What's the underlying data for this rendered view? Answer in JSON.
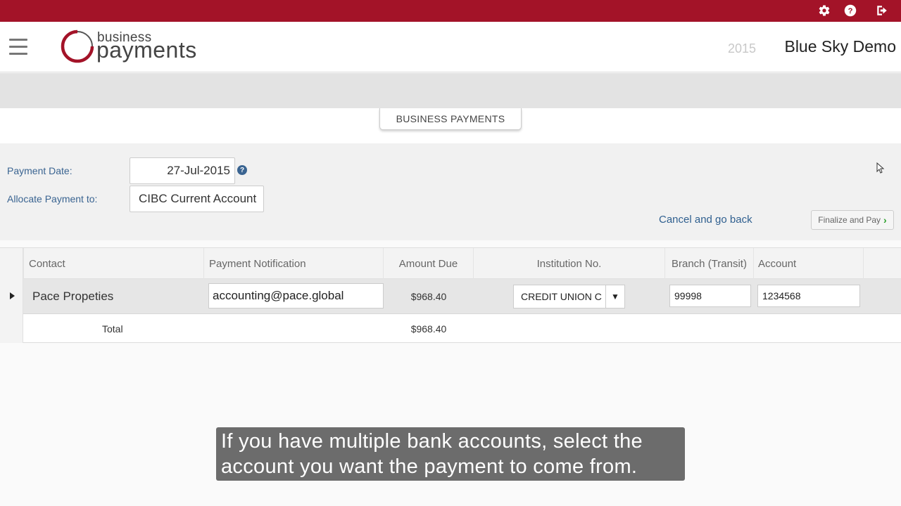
{
  "topbar": {
    "icons": [
      "gear-icon",
      "help-icon",
      "logout-icon"
    ],
    "color": "#a31328"
  },
  "header": {
    "logo_small": "business",
    "logo_big": "payments",
    "year": "2015",
    "company": "Blue Sky Demo"
  },
  "tabs": {
    "active": "BUSINESS PAYMENTS"
  },
  "form": {
    "payment_date_label": "Payment Date:",
    "payment_date_value": "27-Jul-2015",
    "allocate_label": "Allocate Payment to:",
    "allocate_value": "CIBC Current Account",
    "cancel_label": "Cancel and go back",
    "finalize_label": "Finalize and Pay"
  },
  "table": {
    "headers": [
      "Contact",
      "Payment Notification",
      "Amount Due",
      "Institution No.",
      "Branch (Transit)",
      "Account"
    ],
    "row": {
      "contact": "Pace Propeties",
      "notification": "accounting@pace.global",
      "amount_due": "$968.40",
      "institution": "CREDIT UNION C",
      "branch": "99998",
      "account": "1234568"
    },
    "total_label": "Total",
    "total_amount": "$968.40"
  },
  "caption": {
    "line1": "If you have multiple bank accounts, select the",
    "line2": "account you want the payment to come from."
  }
}
